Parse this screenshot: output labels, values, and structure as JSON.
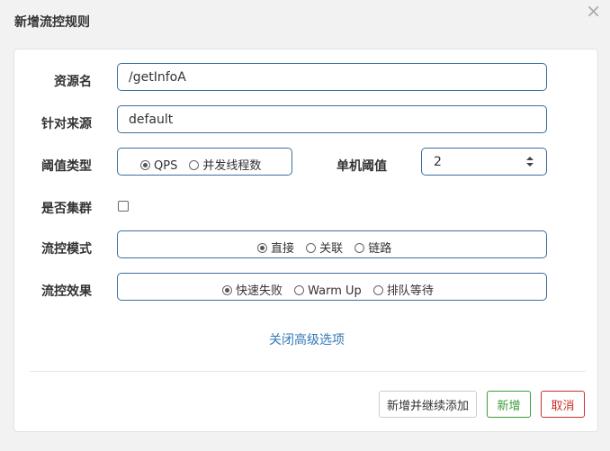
{
  "dialog": {
    "title": "新增流控规则",
    "close_icon": "×"
  },
  "form": {
    "resource": {
      "label": "资源名",
      "value": "/getInfoA"
    },
    "origin": {
      "label": "针对来源",
      "value": "default"
    },
    "threshold_type": {
      "label": "阈值类型",
      "options": [
        {
          "label": "QPS",
          "selected": true
        },
        {
          "label": "并发线程数",
          "selected": false
        }
      ]
    },
    "single_threshold": {
      "label": "单机阈值",
      "value": "2"
    },
    "cluster": {
      "label": "是否集群",
      "checked": false
    },
    "control_mode": {
      "label": "流控模式",
      "options": [
        {
          "label": "直接",
          "selected": true
        },
        {
          "label": "关联",
          "selected": false
        },
        {
          "label": "链路",
          "selected": false
        }
      ]
    },
    "control_effect": {
      "label": "流控效果",
      "options": [
        {
          "label": "快速失败",
          "selected": true
        },
        {
          "label": "Warm Up",
          "selected": false
        },
        {
          "label": "排队等待",
          "selected": false
        }
      ]
    },
    "advanced_toggle": "关闭高级选项"
  },
  "footer": {
    "add_continue": "新增并继续添加",
    "add": "新增",
    "cancel": "取消"
  },
  "colors": {
    "border_accent": "#3c6e9f",
    "link": "#337ab7",
    "add_green": "#3c9c3c",
    "cancel_red": "#c9302c"
  }
}
